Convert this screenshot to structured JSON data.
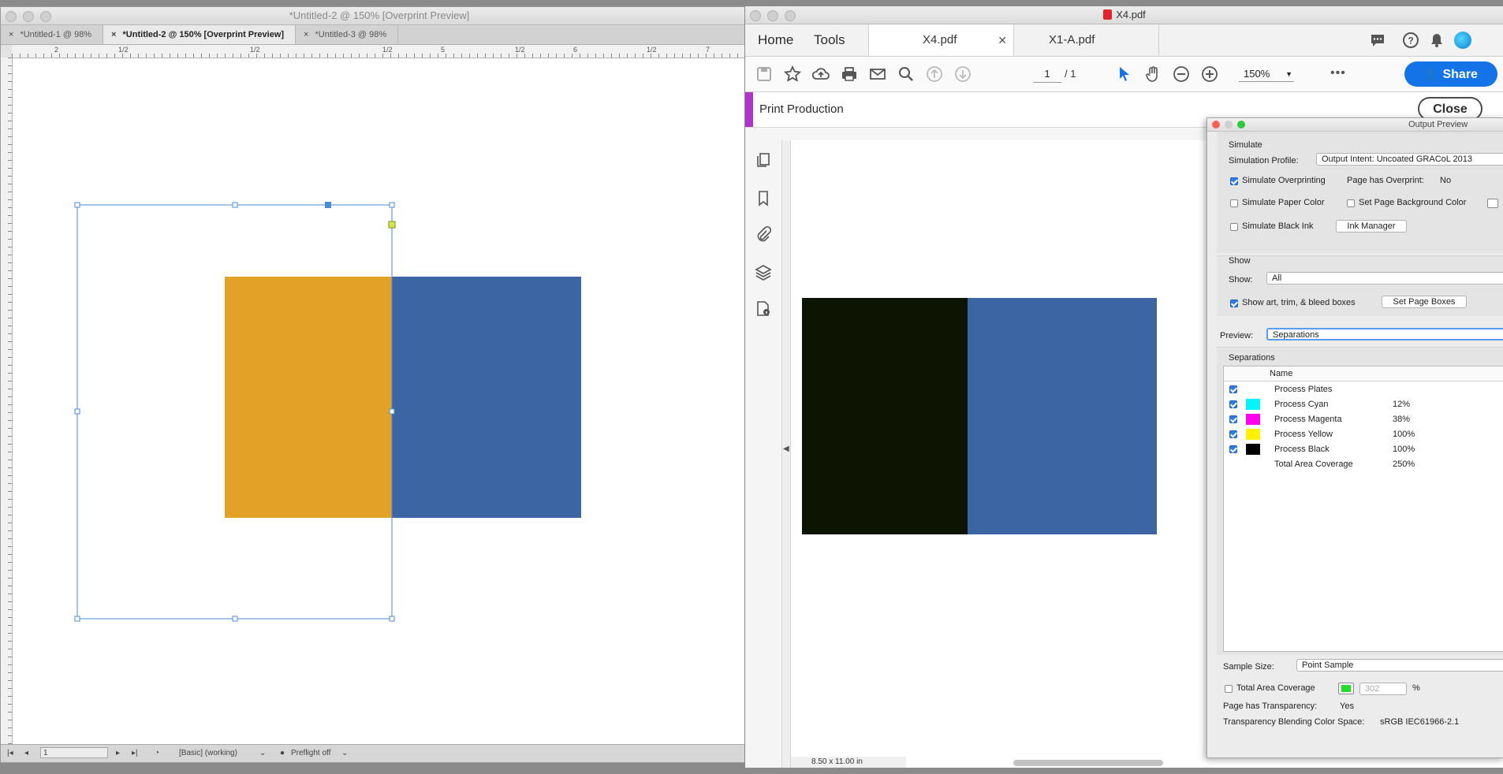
{
  "indesign": {
    "title": "*Untitled-2 @ 150% [Overprint Preview]",
    "tabs": [
      {
        "label": "*Untitled-1 @ 98%"
      },
      {
        "label": "*Untitled-2 @ 150% [Overprint Preview]"
      },
      {
        "label": "*Untitled-3 @ 98%"
      }
    ],
    "ruler_labels": [
      "2",
      "1/2",
      "1/2",
      "1/2",
      "5",
      "1/2",
      "6",
      "1/2",
      "7"
    ],
    "status": {
      "page": "1",
      "style": "[Basic] (working)",
      "preflight": "Preflight off"
    },
    "colors": {
      "orange": "#e3a227",
      "blue": "#3c66a3",
      "frame": "#4a8bd6"
    }
  },
  "acrobat": {
    "title": "X4.pdf",
    "nav": {
      "home": "Home",
      "tools": "Tools"
    },
    "doc_tabs": [
      {
        "label": "X4.pdf"
      },
      {
        "label": "X1-A.pdf"
      }
    ],
    "toolbar": {
      "page_current": "1",
      "page_total": "/ 1",
      "zoom": "150%",
      "share_label": "Share"
    },
    "print_production": {
      "title": "Print Production",
      "close_label": "Close"
    },
    "doc_size": "8.50 x 11.00 in",
    "colors": {
      "accent": "#b233c9",
      "share": "#1473e6",
      "dark_block": "#0d1502",
      "blue_block": "#3c66a3"
    }
  },
  "output_preview": {
    "title": "Output Preview",
    "simulate": {
      "heading": "Simulate",
      "profile_label": "Simulation Profile:",
      "profile_value": "Output Intent: Uncoated GRACoL 2013",
      "simulate_overprinting": "Simulate Overprinting",
      "page_has_overprint_label": "Page has Overprint:",
      "page_has_overprint_value": "No",
      "simulate_paper_color": "Simulate Paper Color",
      "set_page_background_color": "Set Page Background Color",
      "simulate_black_ink": "Simulate Black Ink",
      "ink_manager": "Ink Manager"
    },
    "show": {
      "heading": "Show",
      "label": "Show:",
      "value": "All",
      "art_trim_bleed": "Show art, trim, & bleed boxes",
      "set_page_boxes": "Set Page Boxes"
    },
    "preview": {
      "label": "Preview:",
      "value": "Separations"
    },
    "separations": {
      "heading": "Separations",
      "column_name": "Name",
      "rows": [
        {
          "name": "Process Plates",
          "pct": "",
          "color": "",
          "checked": true
        },
        {
          "name": "Process Cyan",
          "pct": "12%",
          "color": "#00f5ff",
          "checked": true
        },
        {
          "name": "Process Magenta",
          "pct": "38%",
          "color": "#ff00f0",
          "checked": true
        },
        {
          "name": "Process Yellow",
          "pct": "100%",
          "color": "#fff200",
          "checked": true
        },
        {
          "name": "Process Black",
          "pct": "100%",
          "color": "#000000",
          "checked": true
        },
        {
          "name": "Total Area Coverage",
          "pct": "250%",
          "color": "",
          "checked": false
        }
      ]
    },
    "sample_size": {
      "label": "Sample Size:",
      "value": "Point Sample"
    },
    "total_area_coverage": {
      "label": "Total Area Coverage",
      "value": "302",
      "unit": "%",
      "swatch": "#22e02a"
    },
    "transparency": {
      "label": "Page has Transparency:",
      "value": "Yes"
    },
    "blending": {
      "label": "Transparency Blending Color Space:",
      "value": "sRGB IEC61966-2.1"
    }
  }
}
